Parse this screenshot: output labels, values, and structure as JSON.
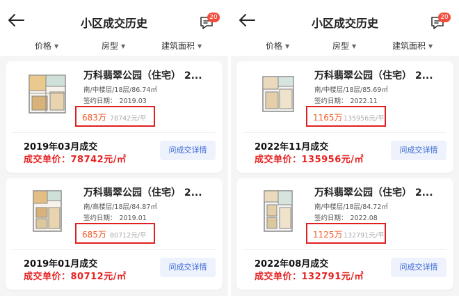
{
  "panels": [
    {
      "header": {
        "title": "小区成交历史",
        "badge": "20"
      },
      "filters": [
        "价格",
        "房型",
        "建筑面积"
      ],
      "records": [
        {
          "name": "万科翡翠公园（住宅） 2...",
          "spec": "南/中楼层/18层/86.74㎡",
          "date_label": "签约日期：",
          "date": "2019.03",
          "total": "683万",
          "unit_price": "78742元/平",
          "month": "2019年03月成交",
          "deal": "成交单价：78742元/㎡",
          "button": "问成交详情"
        },
        {
          "name": "万科翡翠公园（住宅） 2...",
          "spec": "南/高楼层/18层/84.87㎡",
          "date_label": "签约日期：",
          "date": "2019.01",
          "total": "685万",
          "unit_price": "80712元/平",
          "month": "2019年01月成交",
          "deal": "成交单价：80712元/㎡",
          "button": "问成交详情"
        }
      ]
    },
    {
      "header": {
        "title": "小区成交历史",
        "badge": "20"
      },
      "filters": [
        "价格",
        "房型",
        "建筑面积"
      ],
      "records": [
        {
          "name": "万科翡翠公园（住宅） 2...",
          "spec": "南/中楼层/18层/85.69㎡",
          "date_label": "签约日期：",
          "date": "2022.11",
          "total": "1165万",
          "unit_price": "135956元/平",
          "month": "2022年11月成交",
          "deal": "成交单价：135956元/㎡",
          "button": "问成交详情"
        },
        {
          "name": "万科翡翠公园（住宅） 2...",
          "spec": "南/中楼层/18层/84.72㎡",
          "date_label": "签约日期：",
          "date": "2022.08",
          "total": "1125万",
          "unit_price": "132791元/平",
          "month": "2022年08月成交",
          "deal": "成交单价：132791元/㎡",
          "button": "问成交详情"
        }
      ]
    }
  ],
  "icons": {
    "back": "arrow-left-icon",
    "messages": "chat-bubble-icon",
    "filter_caret": "caret-down-icon",
    "floor_plan": "floor-plan-image"
  },
  "colors": {
    "price_highlight_border": "#e02020",
    "total_price": "#f05a28",
    "deal_price": "#e62222",
    "badge": "#f24c3d",
    "detail_button_bg": "#eef2fc",
    "detail_button_text": "#3867d6"
  }
}
